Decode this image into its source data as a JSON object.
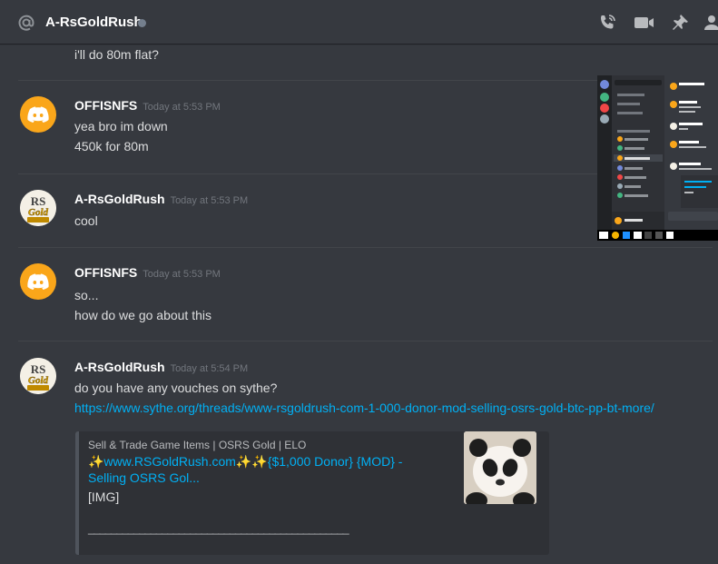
{
  "header": {
    "channel_name": "A-RsGoldRush",
    "icons": [
      "at-icon",
      "status-dot",
      "call-icon",
      "video-icon",
      "pin-icon",
      "members-icon"
    ]
  },
  "messages": [
    {
      "type": "continuation",
      "lines": [
        "i'll do 80m flat?"
      ]
    },
    {
      "author": "OFFISNFS",
      "timestamp": "Today at 5:53 PM",
      "avatar": "discord-logo",
      "lines": [
        "yea bro im down",
        "450k for 80m"
      ]
    },
    {
      "author": "A-RsGoldRush",
      "timestamp": "Today at 5:53 PM",
      "avatar": "rsgoldrush-logo",
      "lines": [
        "cool"
      ]
    },
    {
      "author": "OFFISNFS",
      "timestamp": "Today at 5:53 PM",
      "avatar": "discord-logo",
      "lines": [
        "so...",
        "how do we go about this"
      ]
    },
    {
      "author": "A-RsGoldRush",
      "timestamp": "Today at 5:54 PM",
      "avatar": "rsgoldrush-logo",
      "lines": [
        "do you have any vouches on sythe?"
      ],
      "link": "https://www.sythe.org/threads/www-rsgoldrush-com-1-000-donor-mod-selling-osrs-gold-btc-pp-bt-more/",
      "embed": {
        "provider": "Sell & Trade Game Items | OSRS Gold | ELO",
        "title": "✨www.RSGoldRush.com✨✨{$1,000 Donor} {MOD} - Selling OSRS Gol...",
        "description": "[IMG]",
        "rule": "______________________________________________"
      }
    }
  ],
  "colors": {
    "accent_link": "#00b0f4",
    "discord_orange": "#faa61a",
    "background": "#36393f"
  }
}
